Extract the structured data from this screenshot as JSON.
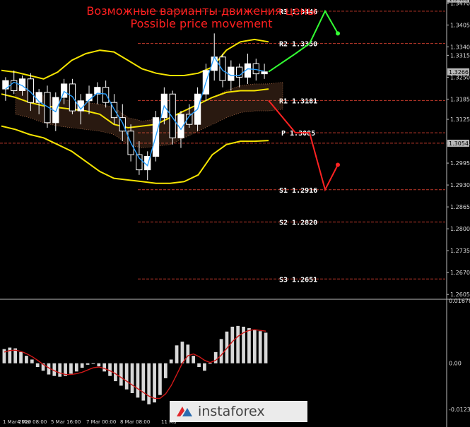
{
  "title": {
    "ru": "Возможные варианты движения цены",
    "en": "Possible price movement"
  },
  "colors": {
    "background": "#000000",
    "levels": "#c0392b",
    "bollinger": "#f5e400",
    "price_line": "#2aa0ff",
    "up_arrow": "#33ff33",
    "down_arrow": "#ff2222",
    "macd_hist": "#d8d8d8",
    "macd_signal": "#d01818",
    "kijun": "#22aa22",
    "axis_text": "#dddddd"
  },
  "logo": {
    "text": "instaforex",
    "icon": "instaforex-logo-icon"
  },
  "chart_data": [
    {
      "type": "candlestick",
      "title": "",
      "xlabel": "",
      "ylabel": "",
      "ylim": [
        1.2595,
        1.3475
      ],
      "grid": false,
      "y_ticks": [
        "1.3470",
        "1.3405",
        "1.3340",
        "1.3315",
        "1.3250",
        "1.3185",
        "1.3125",
        "1.3054",
        "1.2995",
        "1.2930",
        "1.2865",
        "1.2800",
        "1.2735",
        "1.2670",
        "1.2605"
      ],
      "price_tags": [
        {
          "label": "1.3482",
          "value": 1.3482
        },
        {
          "label": "1.3266",
          "value": 1.3266
        },
        {
          "label": "1.3054",
          "value": 1.3054
        }
      ],
      "x_ticks": [
        "1 Mar 2020",
        "4 Mar 08:00",
        "5 Mar 16:00",
        "7 Mar 00:00",
        "8 Mar 08:00",
        "11 Ma"
      ],
      "pivot_levels": [
        {
          "name": "R3",
          "label": "R3 1.3446",
          "value": 1.3446
        },
        {
          "name": "R2",
          "label": "R2 1.3350",
          "value": 1.335
        },
        {
          "name": "R1",
          "label": "R1 1.3181",
          "value": 1.3181
        },
        {
          "name": "P",
          "label": "P 1.3085",
          "value": 1.3085
        },
        {
          "name": "S1",
          "label": "S1 1.2916",
          "value": 1.2916
        },
        {
          "name": "S2",
          "label": "S2 1.2820",
          "value": 1.282
        },
        {
          "name": "S3",
          "label": "S3 1.2651",
          "value": 1.2651
        }
      ],
      "candles": [
        [
          1.3215,
          1.325,
          1.318,
          1.324
        ],
        [
          1.324,
          1.327,
          1.32,
          1.321
        ],
        [
          1.321,
          1.3255,
          1.3195,
          1.3245
        ],
        [
          1.3245,
          1.3262,
          1.315,
          1.3175
        ],
        [
          1.3175,
          1.3215,
          1.314,
          1.3205
        ],
        [
          1.3205,
          1.3225,
          1.31,
          1.3115
        ],
        [
          1.3115,
          1.3205,
          1.309,
          1.319
        ],
        [
          1.319,
          1.3245,
          1.317,
          1.323
        ],
        [
          1.323,
          1.3245,
          1.314,
          1.315
        ],
        [
          1.315,
          1.32,
          1.311,
          1.318
        ],
        [
          1.318,
          1.3225,
          1.314,
          1.32
        ],
        [
          1.32,
          1.3235,
          1.317,
          1.322
        ],
        [
          1.322,
          1.324,
          1.316,
          1.3175
        ],
        [
          1.3175,
          1.32,
          1.311,
          1.313
        ],
        [
          1.313,
          1.317,
          1.306,
          1.309
        ],
        [
          1.309,
          1.311,
          1.3,
          1.302
        ],
        [
          1.302,
          1.306,
          1.296,
          1.2975
        ],
        [
          1.2975,
          1.303,
          1.2945,
          1.3015
        ],
        [
          1.3015,
          1.315,
          1.3,
          1.313
        ],
        [
          1.313,
          1.322,
          1.311,
          1.32
        ],
        [
          1.32,
          1.321,
          1.305,
          1.307
        ],
        [
          1.307,
          1.315,
          1.304,
          1.314
        ],
        [
          1.314,
          1.317,
          1.31,
          1.311
        ],
        [
          1.311,
          1.322,
          1.309,
          1.32
        ],
        [
          1.32,
          1.329,
          1.318,
          1.327
        ],
        [
          1.327,
          1.338,
          1.324,
          1.331
        ],
        [
          1.331,
          1.332,
          1.322,
          1.324
        ],
        [
          1.324,
          1.33,
          1.321,
          1.328
        ],
        [
          1.328,
          1.329,
          1.322,
          1.325
        ],
        [
          1.325,
          1.332,
          1.323,
          1.329
        ],
        [
          1.329,
          1.3305,
          1.324,
          1.326
        ],
        [
          1.326,
          1.329,
          1.3245,
          1.3266
        ]
      ],
      "bollinger_upper": [
        1.327,
        1.3265,
        1.3255,
        1.3245,
        1.3265,
        1.33,
        1.332,
        1.333,
        1.3325,
        1.33,
        1.3275,
        1.3262,
        1.3255,
        1.3255,
        1.3262,
        1.328,
        1.333,
        1.3355,
        1.3362,
        1.3355
      ],
      "bollinger_mid": [
        1.32,
        1.319,
        1.3175,
        1.3165,
        1.316,
        1.3155,
        1.315,
        1.314,
        1.311,
        1.31,
        1.3105,
        1.311,
        1.313,
        1.315,
        1.317,
        1.319,
        1.3205,
        1.321,
        1.321,
        1.3215
      ],
      "bollinger_lower": [
        1.3105,
        1.3095,
        1.308,
        1.307,
        1.305,
        1.303,
        1.3,
        1.297,
        1.295,
        1.2945,
        1.294,
        1.2935,
        1.2935,
        1.294,
        1.296,
        1.302,
        1.305,
        1.306,
        1.306,
        1.3062
      ],
      "forecast": {
        "up": [
          [
            1.3266,
            1.332
          ],
          [
            1.332,
            1.335
          ],
          [
            1.335,
            1.3446
          ],
          [
            1.3446,
            1.338
          ]
        ],
        "down": [
          [
            1.3181,
            1.3085
          ],
          [
            1.3085,
            1.3085
          ],
          [
            1.3085,
            1.2916
          ],
          [
            1.2916,
            1.299
          ]
        ]
      }
    },
    {
      "type": "bar",
      "title": "",
      "ylim": [
        -0.01235,
        0.01678
      ],
      "y_ticks": [
        "0.01678",
        "0.00",
        "-0.01235"
      ],
      "values": [
        0.0038,
        0.0042,
        0.004,
        0.003,
        0.002,
        0.001,
        -0.001,
        -0.002,
        -0.003,
        -0.0034,
        -0.0036,
        -0.0034,
        -0.0028,
        -0.0022,
        -0.0012,
        -0.0004,
        0.0,
        -0.0008,
        -0.0022,
        -0.0034,
        -0.0048,
        -0.006,
        -0.007,
        -0.008,
        -0.0092,
        -0.01,
        -0.011,
        -0.0105,
        -0.0085,
        -0.004,
        0.001,
        0.0048,
        0.0058,
        0.005,
        0.002,
        -0.001,
        -0.002,
        0.0,
        0.003,
        0.0065,
        0.0085,
        0.0098,
        0.01,
        0.0098,
        0.0094,
        0.009,
        0.0086,
        0.0082
      ],
      "signal": [
        0.003,
        0.0034,
        0.0035,
        0.0032,
        0.0026,
        0.0018,
        0.0008,
        -0.0003,
        -0.0012,
        -0.002,
        -0.0026,
        -0.003,
        -0.003,
        -0.0028,
        -0.0024,
        -0.0018,
        -0.0012,
        -0.001,
        -0.0014,
        -0.002,
        -0.0028,
        -0.0038,
        -0.0048,
        -0.0058,
        -0.0068,
        -0.0078,
        -0.0088,
        -0.0094,
        -0.0094,
        -0.0082,
        -0.006,
        -0.003,
        0.0,
        0.002,
        0.0025,
        0.0018,
        0.0008,
        0.0002,
        0.0008,
        0.0022,
        0.004,
        0.0058,
        0.0072,
        0.0082,
        0.0088,
        0.009,
        0.0088,
        0.0086
      ]
    }
  ]
}
